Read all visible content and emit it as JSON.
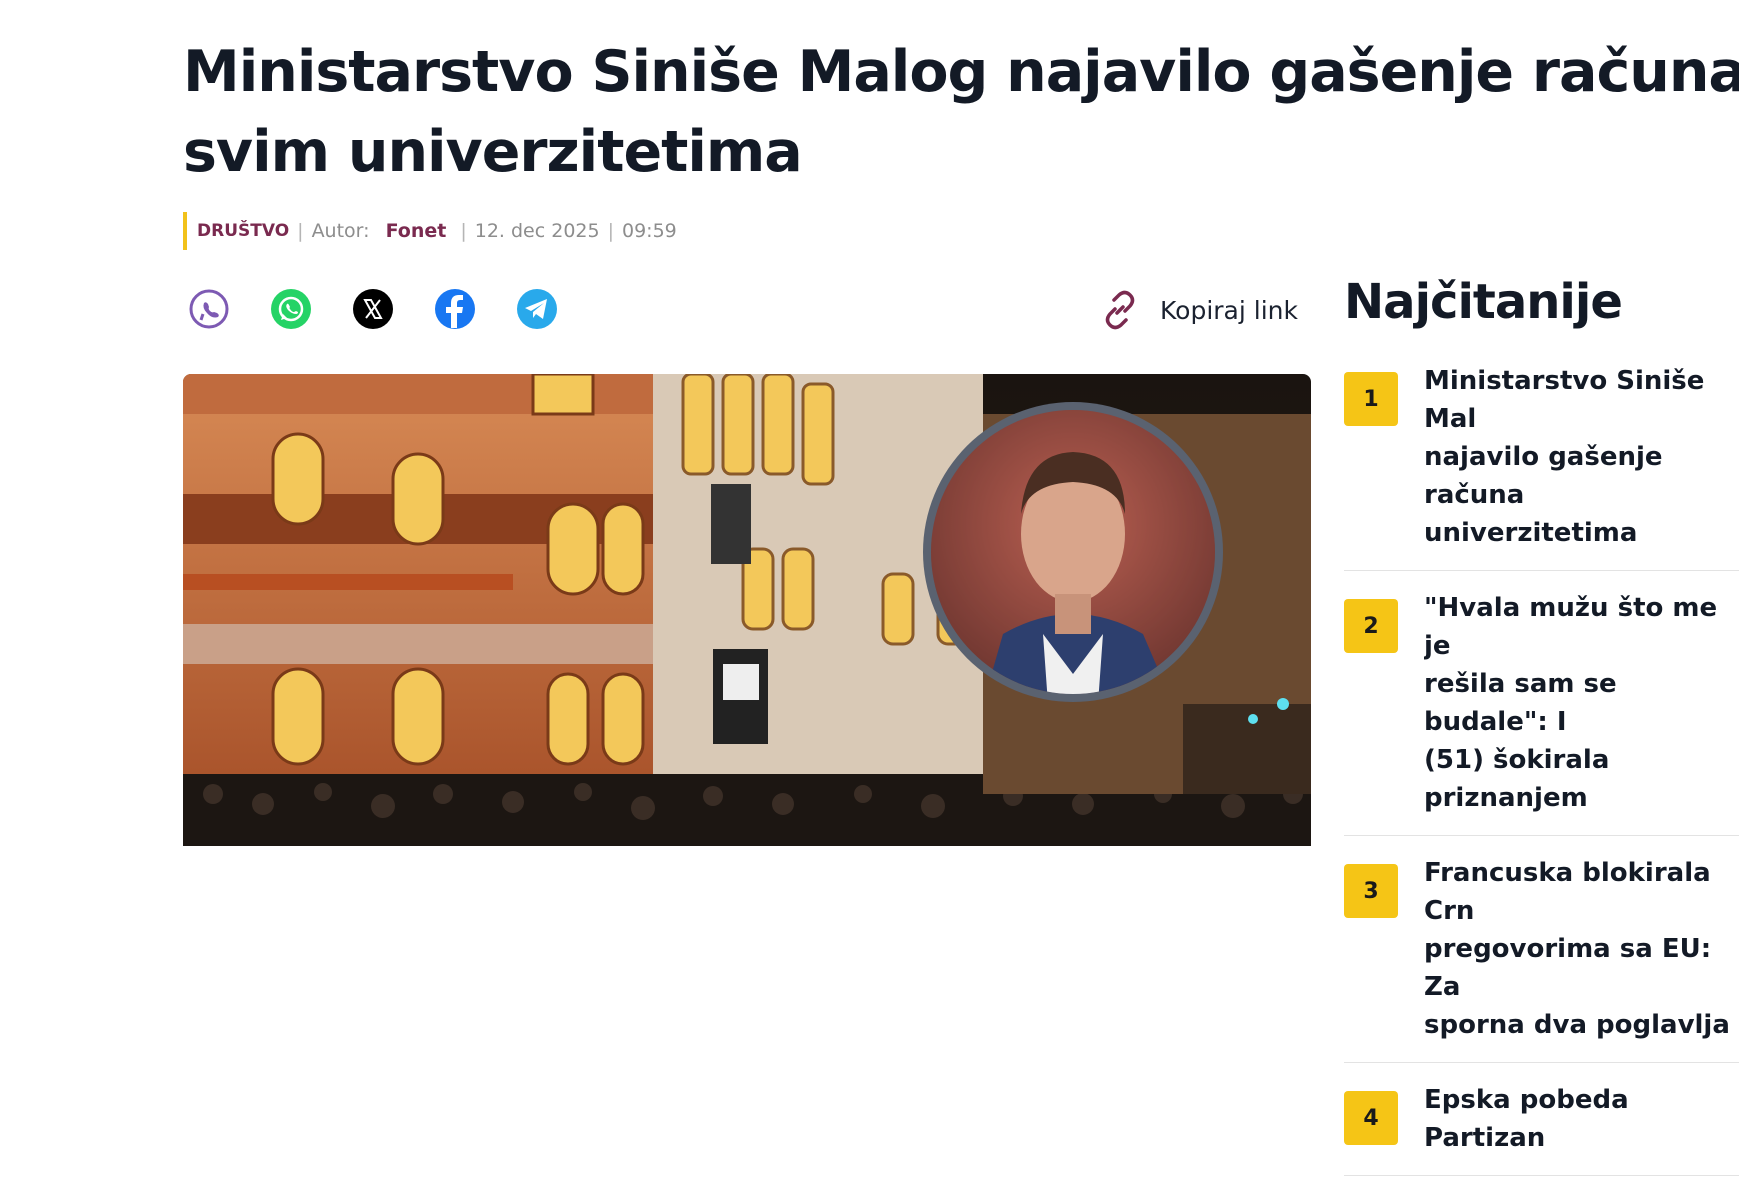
{
  "article": {
    "title_line1": "Ministarstvo Siniše Malog najavilo gašenje računa",
    "title_line2": "svim univerzitetima",
    "category": "DRUŠTVO",
    "author_label": "Autor:",
    "author_name": "Fonet",
    "date": "12. dec 2025",
    "time": "09:59"
  },
  "share": {
    "icons": [
      "viber-icon",
      "whatsapp-icon",
      "x-icon",
      "facebook-icon",
      "telegram-icon"
    ],
    "copy_link_label": "Kopiraj link"
  },
  "colors": {
    "accent": "#f5c516",
    "category": "#7a2a4f",
    "title": "#131a26"
  },
  "sidebar": {
    "title": "Najčitanije",
    "items": [
      {
        "rank": "1",
        "title": "Ministarstvo Siniše Mal\nnajavilo gašenje računa\nuniverzitetima"
      },
      {
        "rank": "2",
        "title": "\"Hvala mužu što me je\nrešila sam se budale\": I\n(51) šokirala priznanjem"
      },
      {
        "rank": "3",
        "title": "Francuska blokirala Crn\npregovorima sa EU: Za\nsporna dva poglavlja"
      },
      {
        "rank": "4",
        "title": "Epska pobeda Partizan"
      }
    ]
  }
}
